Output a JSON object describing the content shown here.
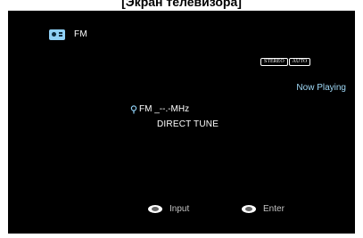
{
  "caption": "[Экран телевизора]",
  "screen": {
    "source_icon": "tuner-radio-icon",
    "source_label": "FM",
    "badges": [
      "STEREO",
      "AUTO"
    ],
    "status": "Now Playing",
    "frequency_icon": "antenna-pin-icon",
    "frequency_text": "FM _--.-MHz",
    "mode": "DIRECT TUNE",
    "hints": {
      "input_icon": "input-disc-icon",
      "input_label": "Input",
      "enter_icon": "enter-disc-icon",
      "enter_label": "Enter"
    }
  },
  "colors": {
    "screen_bg": "#000000",
    "accent": "#9fd8f6",
    "text": "#ffffff",
    "hint_text": "#c4c4c4"
  }
}
